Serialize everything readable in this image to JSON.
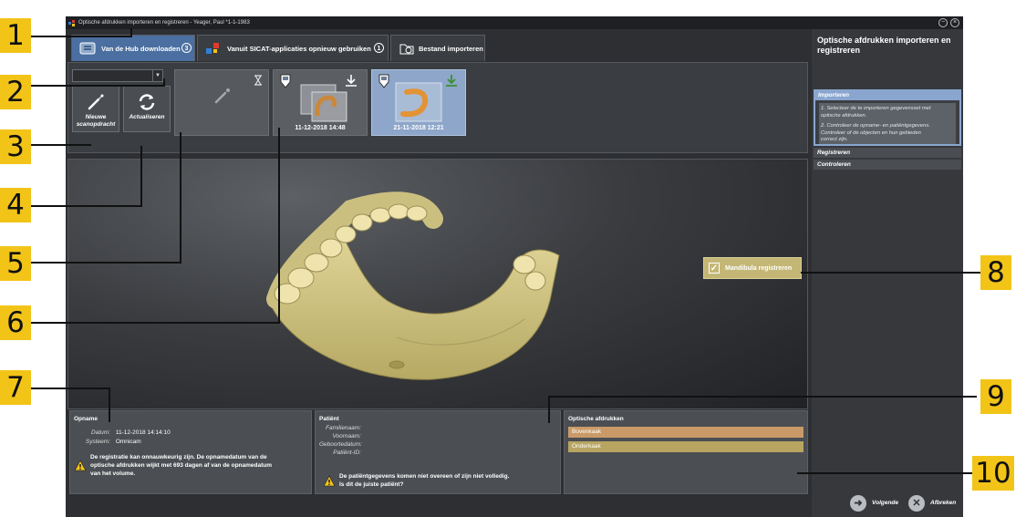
{
  "window": {
    "title": "Optische afdrukken importeren en registreren - Yeager, Paul *1-1-1983"
  },
  "tabs": [
    {
      "label": "Van de Hub downloaden",
      "badge": "3"
    },
    {
      "label": "Vanuit SICAT-applicaties opnieuw gebruiken",
      "badge": "1"
    },
    {
      "label": "Bestand importeren"
    }
  ],
  "user_select": {
    "value": ""
  },
  "buttons": {
    "new_scan_line1": "Nieuwe",
    "new_scan_line2": "scanopdracht",
    "refresh": "Actualiseren"
  },
  "tiles": [
    {
      "date": ""
    },
    {
      "date": "11-12-2018 14:48"
    },
    {
      "date": "21-11-2018 12:21"
    }
  ],
  "mandibula": {
    "label": "Mandibula registreren",
    "checked": true
  },
  "recording": {
    "title": "Opname",
    "date_label": "Datum:",
    "date_value": "11-12-2018 14:14:10",
    "system_label": "Systeem:",
    "system_value": "Omnicam",
    "warning_line1": "De registratie kan onnauwkeurig zijn. De opnamedatum van de",
    "warning_line2": "optische afdrukken wijkt met 693 dagen af van de opnamedatum",
    "warning_line3": "van het volume."
  },
  "patient": {
    "title": "Patiënt",
    "family_label": "Familienaam:",
    "first_label": "Voornaam:",
    "birth_label": "Geboortedatum:",
    "id_label": "Patiënt-ID:",
    "warning_line1": "De patiëntgegevens komen niet overeen of zijn niet volledig.",
    "warning_line2": "Is dit de juiste patiënt?"
  },
  "impressions": {
    "title": "Optische afdrukken",
    "items": [
      {
        "label": "Bovenkaak",
        "color": "#c99a68"
      },
      {
        "label": "Onderkaak",
        "color": "#b8a561"
      }
    ]
  },
  "sidepanel": {
    "title": "Optische afdrukken importeren en registreren",
    "step_active": "Importeren",
    "step_text_1a": "1. Selecteer de te importeren gegevensset met",
    "step_text_1b": "optische afdrukken.",
    "step_text_2a": "2. Controleer de opname- en patiëntgegevens.",
    "step_text_2b": "Controleer of de objecten en hun gebieden",
    "step_text_2c": "correct zijn.",
    "step_2": "Registreren",
    "step_3": "Controleren"
  },
  "footer": {
    "next": "Volgende",
    "cancel": "Afbreken"
  },
  "callouts": [
    "1",
    "2",
    "3",
    "4",
    "5",
    "6",
    "7",
    "8",
    "9",
    "10"
  ],
  "colors": {
    "accent": "#f2c418",
    "active_tab": "#4a6fa0",
    "tooth_model": "#d6c98a"
  }
}
